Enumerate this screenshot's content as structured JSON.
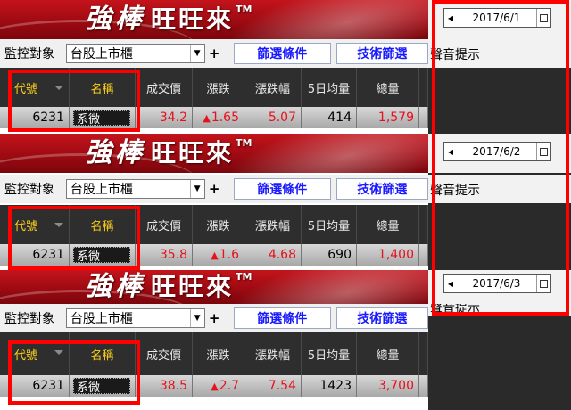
{
  "brand": {
    "strong": "強棒",
    "rest": "旺旺來",
    "tm": "TM"
  },
  "toolbar": {
    "monitor_label": "監控對象",
    "market_select": "台股上市櫃",
    "plus_label": "+",
    "filter_btn": "篩選條件",
    "tech_btn": "技術篩選",
    "sound_label": "聲音提示"
  },
  "columns": [
    "代號",
    "名稱",
    "成交價",
    "漲跌",
    "漲跌幅",
    "5日均量",
    "總量"
  ],
  "snapshots": [
    {
      "date": "2017/6/1",
      "code": "6231",
      "name": "系微",
      "price": "34.2",
      "change_arrow": "▲",
      "change": "1.65",
      "pct": "5.07",
      "avg5": "414",
      "volume": "1,579"
    },
    {
      "date": "2017/6/2",
      "code": "6231",
      "name": "系微",
      "price": "35.8",
      "change_arrow": "▲",
      "change": "1.6",
      "pct": "4.68",
      "avg5": "690",
      "volume": "1,400"
    },
    {
      "date": "2017/6/3",
      "code": "6231",
      "name": "系微",
      "price": "38.5",
      "change_arrow": "▲",
      "change": "2.7",
      "pct": "7.54",
      "avg5": "1423",
      "volume": "3,700"
    }
  ],
  "colors": {
    "accent_red": "#e8101c",
    "header_yellow": "#ffd21a",
    "button_blue": "#1a1aff",
    "highlight_box": "#ff0000"
  },
  "icons": [
    "dropdown-arrow-icon",
    "sort-arrow-icon",
    "date-prev-icon",
    "calendar-icon"
  ]
}
